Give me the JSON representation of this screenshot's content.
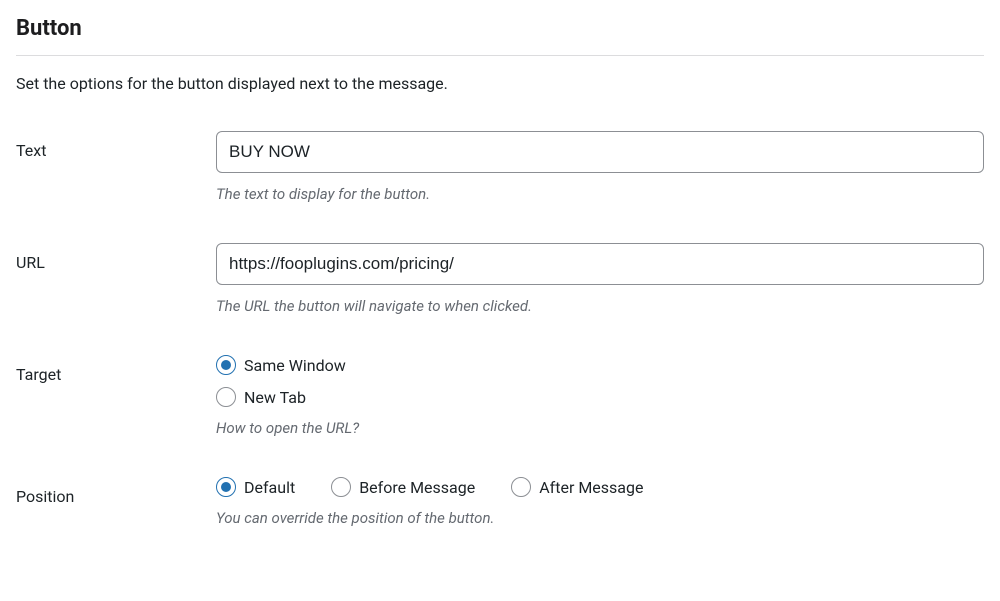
{
  "section": {
    "title": "Button",
    "description": "Set the options for the button displayed next to the message."
  },
  "fields": {
    "text": {
      "label": "Text",
      "value": "BUY NOW",
      "help": "The text to display for the button."
    },
    "url": {
      "label": "URL",
      "value": "https://fooplugins.com/pricing/",
      "help": "The URL the button will navigate to when clicked."
    },
    "target": {
      "label": "Target",
      "help": "How to open the URL?",
      "options": {
        "same_window": "Same Window",
        "new_tab": "New Tab"
      },
      "selected": "same_window"
    },
    "position": {
      "label": "Position",
      "help": "You can override the position of the button.",
      "options": {
        "default": "Default",
        "before": "Before Message",
        "after": "After Message"
      },
      "selected": "default"
    }
  }
}
